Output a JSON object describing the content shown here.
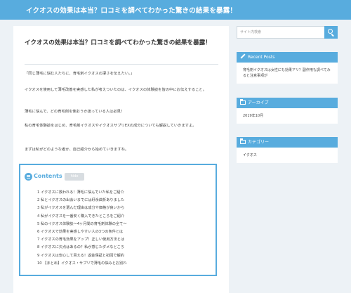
{
  "header": {
    "site_title": "イクオスの効果は本当？口コミを調べてわかった驚きの結果を暴露！"
  },
  "article": {
    "title": "イクオスの効果は本当？口コミを調べてわかった驚きの結果を暴露！",
    "paragraphs": [
      "「同じ薄毛に悩む人たちに、育毛剤イクオスの凄さを伝えたい。」",
      "イクオスを使用して薄毛改善を実感した私が考えついたのは、イクオスの体験談を皆の中にお伝えすること。",
      "薄毛に悩んで、どの育毛剤を使おうか迷っている人は必見！",
      "私の育毛体験談をはじめ、育毛剤イクオスやイクオスサプリEXの成分についても解説していきますよ。",
      "まずは私がどのような者か、自己紹介から始めていきますね。"
    ]
  },
  "toc": {
    "heading": "Contents",
    "toggle_label": "hide",
    "items": [
      "1 イクオスに救われる！薄毛に悩んでいた私をご紹介",
      "2 私とイクオスの出会いまでには紆余曲折ありました",
      "3 私がイクオスを選んだ理由は成分や価格が良いから",
      "4 私がイクオスを一番安く購入できたところをご紹介",
      "5 私のイクオス体験談～4ヶ月間の育毛剤体験の全て～",
      "6 イクオスで効果を実感しやすい人の3つの条件とは",
      "7 イクオスの育毛効果をアップ！正しい使用方法とは",
      "8 イクオスに欠点はあるの？私が感じたダメなところ",
      "9 イクオスは安心して買える！返金保証と初回で解約",
      "10 【まとめ】イクオス・サプリで薄毛の悩みとお別れ"
    ]
  },
  "sidebar": {
    "search": {
      "placeholder": "サイト内検索",
      "value": ""
    },
    "widgets": [
      {
        "heading": "Recent Posts",
        "icon": "pencil-icon",
        "links": [
          "育毛剤イクオスは女性にも効果アリ？副作用も調べてみると注意事項が"
        ]
      },
      {
        "heading": "アーカイブ",
        "icon": "folder-icon",
        "links": [
          "2019年10月"
        ]
      },
      {
        "heading": "カテゴリー",
        "icon": "folder-icon",
        "links": [
          "イクオス"
        ]
      }
    ]
  },
  "colors": {
    "accent": "#58acde",
    "background": "#edf2f6"
  }
}
